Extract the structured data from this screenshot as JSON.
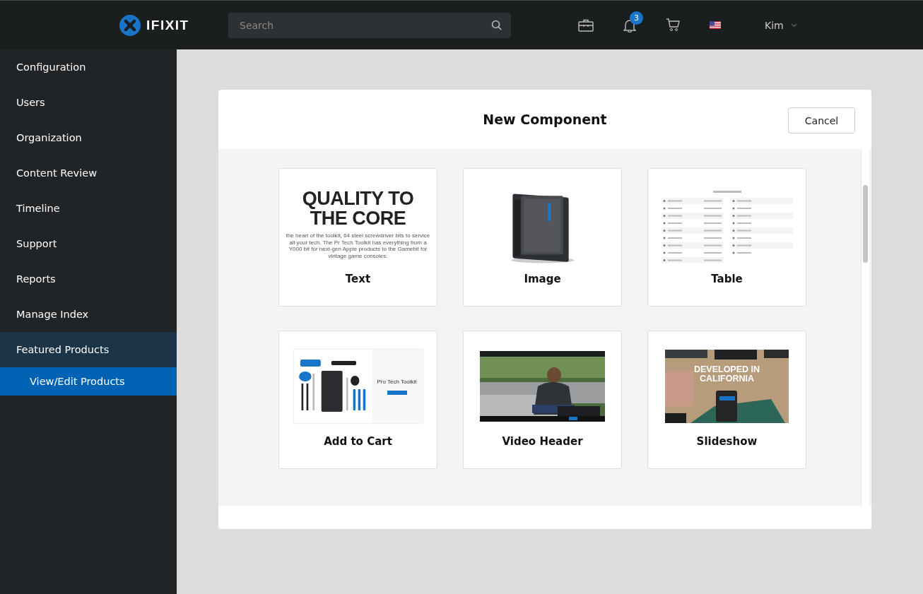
{
  "header": {
    "logo": "IFIXIT",
    "search": {
      "placeholder": "Search"
    },
    "notifications": "3",
    "user": "Kim"
  },
  "sidebar": {
    "items": [
      {
        "label": "Configuration",
        "selected": false
      },
      {
        "label": "Users",
        "selected": false
      },
      {
        "label": "Organization",
        "selected": false
      },
      {
        "label": "Content Review",
        "selected": false
      },
      {
        "label": "Timeline",
        "selected": false
      },
      {
        "label": "Support",
        "selected": false
      },
      {
        "label": "Reports",
        "selected": false
      },
      {
        "label": "Manage Index",
        "selected": false
      },
      {
        "label": "Featured Products",
        "selected": true,
        "expanded": true,
        "children": [
          {
            "label": "View/Edit Products",
            "selected": true
          }
        ]
      }
    ]
  },
  "modal": {
    "title": "New Component",
    "cancel": "Cancel",
    "components": [
      {
        "kind": "text",
        "label": "Text",
        "heading": "QUALITY TO THE CORE",
        "body": "the heart of the toolkit, 64 steel screwdriver bits to service all your tech. The Pr Tech Toolkit has everything from a Y000 bit for next-gen Apple products to the Gamebit for vintage game consoles."
      },
      {
        "label": "Image"
      },
      {
        "kind": "table",
        "label": "Table"
      },
      {
        "kind": "cart",
        "label": "Add to Cart",
        "product": "Pro Tech Toolkit"
      },
      {
        "kind": "video",
        "label": "Video Header"
      },
      {
        "kind": "slideshow",
        "label": "Slideshow",
        "heading": "DEVELOPED IN CALIFORNIA"
      }
    ]
  }
}
